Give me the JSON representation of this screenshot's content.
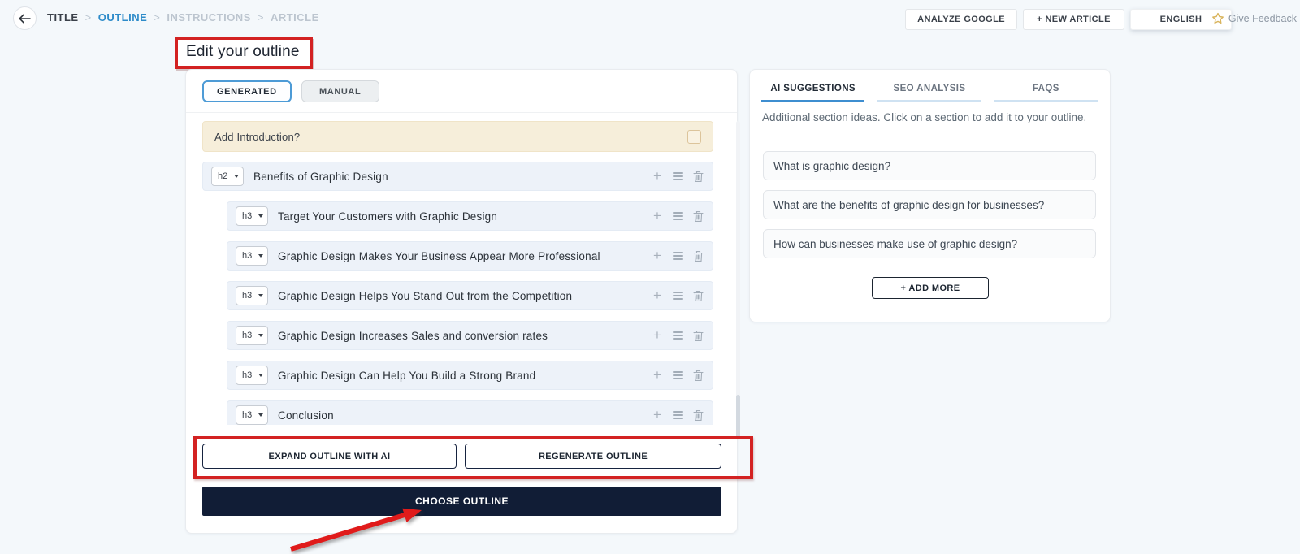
{
  "topbar": {
    "breadcrumb": {
      "separator": ">",
      "items": [
        {
          "label": "TITLE",
          "state": "done"
        },
        {
          "label": "OUTLINE",
          "state": "active"
        },
        {
          "label": "INSTRUCTIONS",
          "state": "upcoming"
        },
        {
          "label": "ARTICLE",
          "state": "upcoming"
        }
      ]
    },
    "actions": {
      "analyze_google": "ANALYZE GOOGLE",
      "new_article": "+ NEW ARTICLE",
      "language": "ENGLISH",
      "feedback": "Give Feedback"
    }
  },
  "page_title": "Edit your outline",
  "outline_panel": {
    "mode_tabs": [
      {
        "label": "GENERATED",
        "active": true
      },
      {
        "label": "MANUAL",
        "active": false
      }
    ],
    "add_introduction": {
      "label": "Add Introduction?",
      "checked": false
    },
    "rows": [
      {
        "level": "h2",
        "title": "Benefits of Graphic Design"
      },
      {
        "level": "h3",
        "title": "Target Your Customers with Graphic Design"
      },
      {
        "level": "h3",
        "title": "Graphic Design Makes Your Business Appear More Professional"
      },
      {
        "level": "h3",
        "title": "Graphic Design Helps You Stand Out from the Competition"
      },
      {
        "level": "h3",
        "title": "Graphic Design Increases Sales and conversion rates"
      },
      {
        "level": "h3",
        "title": "Graphic Design Can Help You Build a Strong Brand"
      },
      {
        "level": "h3",
        "title": "Conclusion"
      }
    ],
    "expand_button": "EXPAND OUTLINE WITH AI",
    "regenerate_button": "REGENERATE OUTLINE",
    "choose_button": "CHOOSE OUTLINE"
  },
  "suggestions_panel": {
    "tabs": [
      {
        "label": "AI SUGGESTIONS",
        "active": true
      },
      {
        "label": "SEO ANALYSIS",
        "active": false
      },
      {
        "label": "FAQS",
        "active": false
      }
    ],
    "description": "Additional section ideas. Click on a section to add it to your outline.",
    "items": [
      "What is graphic design?",
      "What are the benefits of graphic design for businesses?",
      "How can businesses make use of graphic design?"
    ],
    "add_more_button": "+ ADD MORE"
  },
  "glyphs": {
    "plus": "+"
  },
  "icons": {
    "back": "arrow-left",
    "row_add": "plus",
    "row_drag": "drag-handle",
    "row_delete": "trash",
    "feedback": "star",
    "level_select": "chevron-down"
  },
  "colors": {
    "accent_blue": "#2d8bc9",
    "navy": "#111d36",
    "annotation_red": "#d32222",
    "intro_cream": "#f6eeda",
    "row_bg": "#edf2f9",
    "page_bg": "#f4f8fb"
  }
}
